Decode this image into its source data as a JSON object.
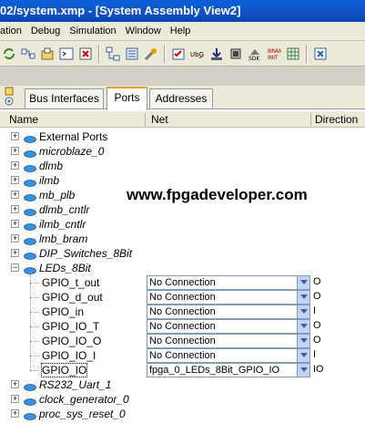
{
  "window": {
    "title": "02/system.xmp - [System Assembly View2]"
  },
  "menu": [
    "ation",
    "Debug",
    "Simulation",
    "Window",
    "Help"
  ],
  "tabs": [
    "Bus Interfaces",
    "Ports",
    "Addresses"
  ],
  "columns": {
    "name": "Name",
    "net": "Net",
    "direction": "Direction"
  },
  "watermark": "www.fpgadeveloper.com",
  "tree": [
    {
      "label": "External Ports",
      "italic": false
    },
    {
      "label": "microblaze_0",
      "italic": true
    },
    {
      "label": "dlmb",
      "italic": true
    },
    {
      "label": "ilmb",
      "italic": true
    },
    {
      "label": "mb_plb",
      "italic": true
    },
    {
      "label": "dlmb_cntlr",
      "italic": true
    },
    {
      "label": "ilmb_cntlr",
      "italic": true
    },
    {
      "label": "lmb_bram",
      "italic": true
    },
    {
      "label": "DIP_Switches_8Bit",
      "italic": true
    },
    {
      "label": "LEDs_8Bit",
      "italic": true,
      "expanded": true
    }
  ],
  "ports": [
    {
      "name": "GPIO_t_out",
      "net": "No Connection",
      "dir": "O"
    },
    {
      "name": "GPIO_d_out",
      "net": "No Connection",
      "dir": "O"
    },
    {
      "name": "GPIO_in",
      "net": "No Connection",
      "dir": "I"
    },
    {
      "name": "GPIO_IO_T",
      "net": "No Connection",
      "dir": "O"
    },
    {
      "name": "GPIO_IO_O",
      "net": "No Connection",
      "dir": "O"
    },
    {
      "name": "GPIO_IO_I",
      "net": "No Connection",
      "dir": "I"
    },
    {
      "name": "GPIO_IO",
      "net": "fpga_0_LEDs_8Bit_GPIO_IO",
      "dir": "IO"
    }
  ],
  "tree_after": [
    {
      "label": "RS232_Uart_1",
      "italic": true
    },
    {
      "label": "clock_generator_0",
      "italic": true
    },
    {
      "label": "proc_sys_reset_0",
      "italic": true
    }
  ],
  "toolbar_icons": [
    "refresh-icon",
    "connect-icon",
    "open-icon",
    "terminal-icon",
    "close-doc-icon",
    "hierarchy-icon",
    "filter-icon",
    "tools-icon",
    "checklist-icon",
    "ubg-icon",
    "download-icon",
    "device-icon",
    "sdk-icon",
    "bram-init-icon",
    "grid-icon",
    "stop-icon"
  ],
  "colors": {
    "title_bar": "#0a5fd8",
    "tab_accent": "#e9a03c",
    "node_icon": "#3a8fd8"
  }
}
